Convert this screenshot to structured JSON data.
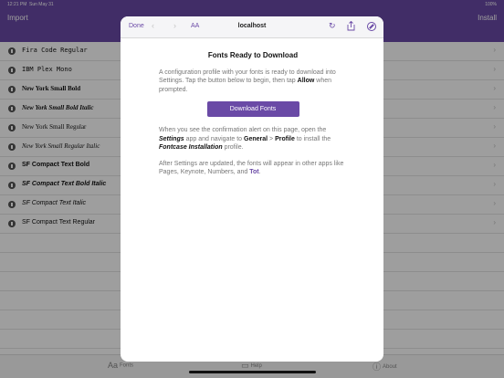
{
  "status_bar": {
    "time": "12:21 PM",
    "date": "Sun May 31",
    "battery": "100%"
  },
  "nav": {
    "import_label": "Import",
    "install_label": "Install"
  },
  "fonts": [
    {
      "name": "Fira Code Regular",
      "style": "mono",
      "weight": "normal",
      "italic": false
    },
    {
      "name": "IBM Plex Mono",
      "style": "mono",
      "weight": "normal",
      "italic": false
    },
    {
      "name": "New York Small Bold",
      "style": "serif",
      "weight": "bold",
      "italic": false
    },
    {
      "name": "New York Small Bold Italic",
      "style": "serif",
      "weight": "bold",
      "italic": true
    },
    {
      "name": "New York Small Regular",
      "style": "serif",
      "weight": "normal",
      "italic": false
    },
    {
      "name": "New York Small Regular Italic",
      "style": "serif",
      "weight": "normal",
      "italic": true
    },
    {
      "name": "SF Compact Text Bold",
      "style": "sans",
      "weight": "bold",
      "italic": false
    },
    {
      "name": "SF Compact Text Bold Italic",
      "style": "sans",
      "weight": "bold",
      "italic": true
    },
    {
      "name": "SF Compact Text Italic",
      "style": "sans",
      "weight": "normal",
      "italic": true
    },
    {
      "name": "SF Compact Text Regular",
      "style": "sans",
      "weight": "normal",
      "italic": false
    }
  ],
  "tabs": {
    "fonts_label": "Fonts",
    "help_label": "Help",
    "about_label": "About"
  },
  "sheet": {
    "done_label": "Done",
    "text_size_label": "AA",
    "url": "localhost",
    "heading": "Fonts Ready to Download",
    "para1_a": "A configuration profile with your fonts is ready to download into Settings. Tap the button below to begin, then tap ",
    "para1_allow": "Allow",
    "para1_b": " when prompted.",
    "download_label": "Download Fonts",
    "para2_a": "When you see the confirmation alert on this page, open the ",
    "para2_settings": "Settings",
    "para2_b": " app and navigate to ",
    "para2_general": "General",
    "para2_c": " > ",
    "para2_profile": "Profile",
    "para2_d": " to install the ",
    "para2_fontcase": "Fontcase Installation",
    "para2_e": " profile.",
    "para3_a": "After Settings are updated, the fonts will appear in other apps like Pages, Keynote, Numbers, and ",
    "para3_tot": "Tot",
    "para3_b": "."
  },
  "colors": {
    "accent": "#6a4aa6",
    "dim": "rgba(0,0,0,0.38)"
  }
}
